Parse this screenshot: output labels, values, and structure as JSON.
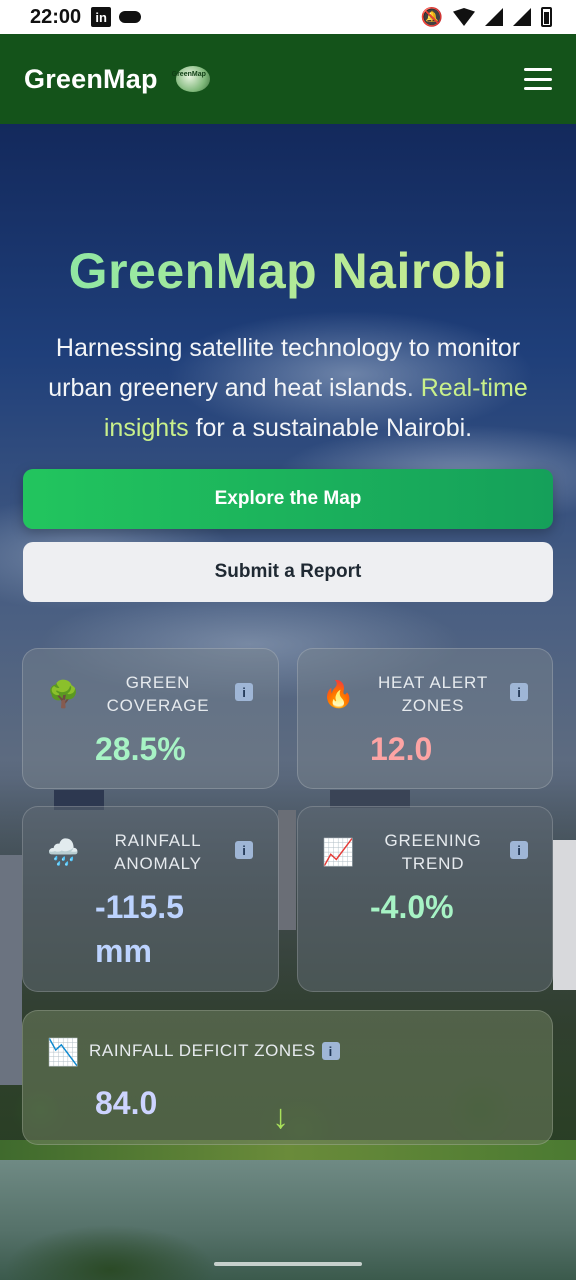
{
  "status_bar": {
    "time": "22:00",
    "app_badge": "in"
  },
  "header": {
    "brand": "GreenMap",
    "logo_text": "GreenMap"
  },
  "hero": {
    "title": "GreenMap Nairobi",
    "subtitle_part1": "Harnessing satellite technology to monitor urban greenery and heat islands. ",
    "subtitle_highlight": "Real-time insights",
    "subtitle_part2": " for a sustainable Nairobi."
  },
  "buttons": {
    "explore": "Explore the Map",
    "report": "Submit a Report"
  },
  "stats": [
    {
      "icon": "🌳",
      "label": "GREEN COVERAGE",
      "value": "28.5%",
      "color": "#a7f3c5"
    },
    {
      "icon": "🔥",
      "label": "HEAT ALERT ZONES",
      "value": "12.0",
      "color": "#fda4a4"
    },
    {
      "icon": "🌧️",
      "label": "RAINFALL ANOMALY",
      "value": "-115.5 mm",
      "color": "#bcd3ff"
    },
    {
      "icon": "📈",
      "label": "GREENING TREND",
      "value": "-4.0%",
      "color": "#a7f3c5"
    },
    {
      "icon": "📉",
      "label": "RAINFALL DEFICIT ZONES",
      "value": "84.0",
      "color": "#cdd4ff"
    }
  ],
  "info_glyph": "i",
  "scroll_arrow": "↓"
}
